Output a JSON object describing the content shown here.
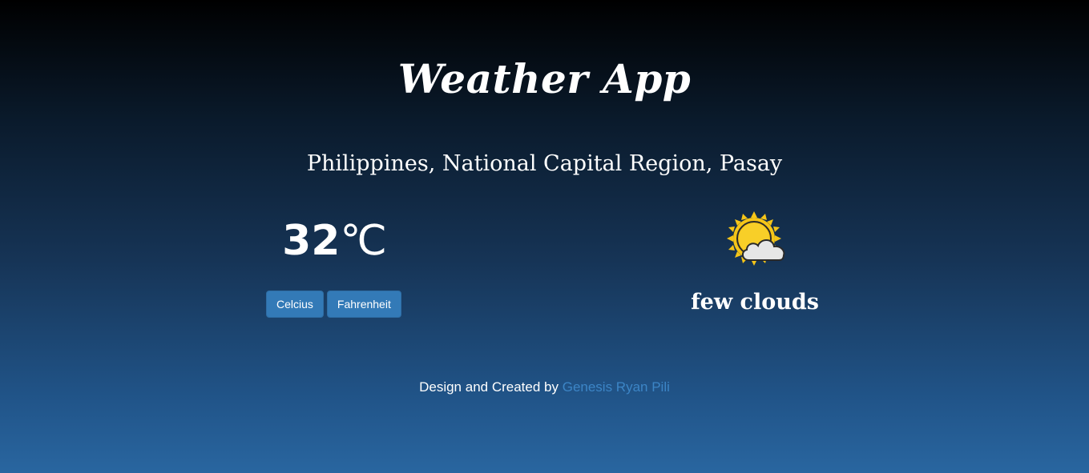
{
  "app": {
    "title": "Weather App"
  },
  "location": {
    "text": "Philippines, National Capital Region, Pasay"
  },
  "temperature": {
    "value": "32",
    "unit": "℃"
  },
  "unit_buttons": {
    "celsius_label": "Celcius",
    "fahrenheit_label": "Fahrenheit"
  },
  "weather": {
    "icon": "sun-behind-cloud-icon",
    "description": "few clouds"
  },
  "footer": {
    "prefix": "Design and Created by",
    "author_link": "Genesis Ryan Pili"
  },
  "colors": {
    "button_bg": "#337ab7",
    "link": "#3c85c6",
    "sun": "#f5c518",
    "cloud": "#e6e6e6"
  }
}
